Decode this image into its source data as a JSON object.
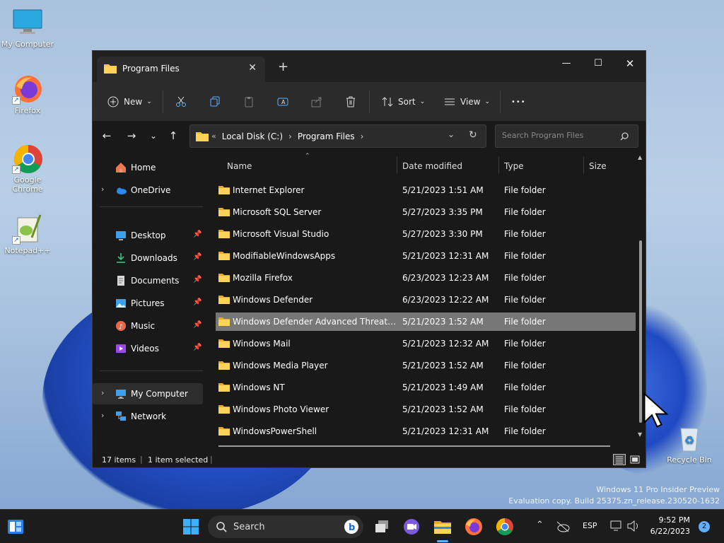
{
  "desktop": {
    "icons": [
      {
        "label": "My Computer"
      },
      {
        "label": "Firefox"
      },
      {
        "label": "Google Chrome"
      },
      {
        "label": "Notepad++"
      },
      {
        "label": "Recycle Bin"
      }
    ],
    "watermark_line1": "Windows 11 Pro Insider Preview",
    "watermark_line2": "Evaluation copy. Build 25375.zn_release.230520-1632"
  },
  "window": {
    "tab_title": "Program Files",
    "tab_close": "✕",
    "new_tab": "+",
    "controls": {
      "minimize": "—",
      "maximize": "☐",
      "close": "✕"
    },
    "toolbar": {
      "new_label": "New",
      "sort_label": "Sort",
      "view_label": "View",
      "more_label": "•••"
    },
    "address": {
      "overflow": "«",
      "crumb1": "Local Disk (C:)",
      "crumb2": "Program Files",
      "sep": "›"
    },
    "search_placeholder": "Search Program Files",
    "nav": {
      "home": "Home",
      "onedrive": "OneDrive",
      "desktop": "Desktop",
      "downloads": "Downloads",
      "documents": "Documents",
      "pictures": "Pictures",
      "music": "Music",
      "videos": "Videos",
      "my_computer": "My Computer",
      "network": "Network"
    },
    "columns": {
      "name": "Name",
      "date": "Date modified",
      "type": "Type",
      "size": "Size"
    },
    "rows": [
      {
        "name": "Internet Explorer",
        "date": "5/21/2023 1:51 AM",
        "type": "File folder"
      },
      {
        "name": "Microsoft SQL Server",
        "date": "5/27/2023 3:35 PM",
        "type": "File folder"
      },
      {
        "name": "Microsoft Visual Studio",
        "date": "5/27/2023 3:30 PM",
        "type": "File folder"
      },
      {
        "name": "ModifiableWindowsApps",
        "date": "5/21/2023 12:31 AM",
        "type": "File folder"
      },
      {
        "name": "Mozilla Firefox",
        "date": "6/23/2023 12:23 AM",
        "type": "File folder"
      },
      {
        "name": "Windows Defender",
        "date": "6/23/2023 12:22 AM",
        "type": "File folder"
      },
      {
        "name": "Windows Defender Advanced Threat Prot...",
        "date": "5/21/2023 1:52 AM",
        "type": "File folder"
      },
      {
        "name": "Windows Mail",
        "date": "5/21/2023 12:32 AM",
        "type": "File folder"
      },
      {
        "name": "Windows Media Player",
        "date": "5/21/2023 1:52 AM",
        "type": "File folder"
      },
      {
        "name": "Windows NT",
        "date": "5/21/2023 1:49 AM",
        "type": "File folder"
      },
      {
        "name": "Windows Photo Viewer",
        "date": "5/21/2023 1:52 AM",
        "type": "File folder"
      },
      {
        "name": "WindowsPowerShell",
        "date": "5/21/2023 12:31 AM",
        "type": "File folder"
      }
    ],
    "status": {
      "items": "17 items",
      "selected": "1 item selected"
    }
  },
  "taskbar": {
    "search_label": "Search",
    "lang": "ESP",
    "time": "9:52 PM",
    "date": "6/22/2023",
    "notif_count": "2"
  },
  "colors": {
    "selection": "#777777",
    "folder": "#f5c842",
    "accent": "#0a64d8"
  }
}
